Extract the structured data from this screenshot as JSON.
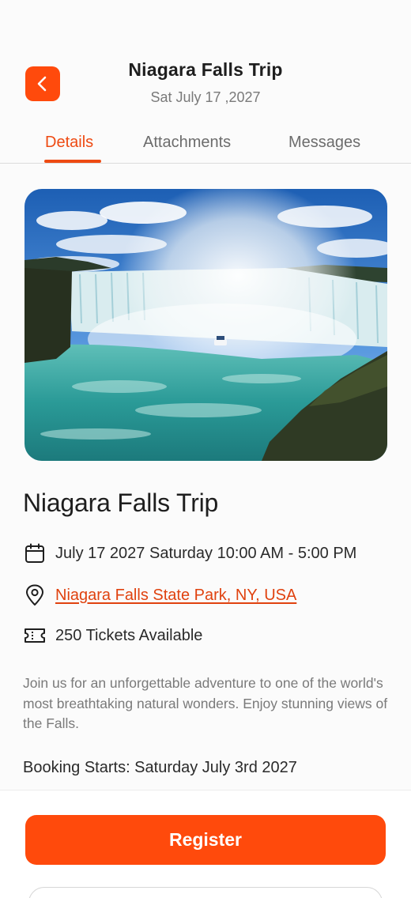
{
  "header": {
    "title": "Niagara Falls Trip",
    "date": "Sat July 17 ,2027",
    "back_icon": "chevron-left-icon"
  },
  "tabs": [
    {
      "label": "Details",
      "active": true
    },
    {
      "label": "Attachments",
      "active": false
    },
    {
      "label": "Messages",
      "active": false
    }
  ],
  "event": {
    "title": "Niagara Falls Trip",
    "datetime": "July 17 2027 Saturday 10:00 AM - 5:00 PM",
    "location": "Niagara Falls State Park, NY, USA",
    "tickets": "250 Tickets Available",
    "description": "Join us for an unforgettable adventure to one of the world's most breathtaking natural wonders. Enjoy stunning views of the Falls.",
    "booking": "Booking Starts: Saturday July 3rd 2027"
  },
  "actions": {
    "register_label": "Register"
  },
  "colors": {
    "accent": "#ff4a0c",
    "accent_text": "#ee4a12",
    "link": "#e0420f"
  }
}
